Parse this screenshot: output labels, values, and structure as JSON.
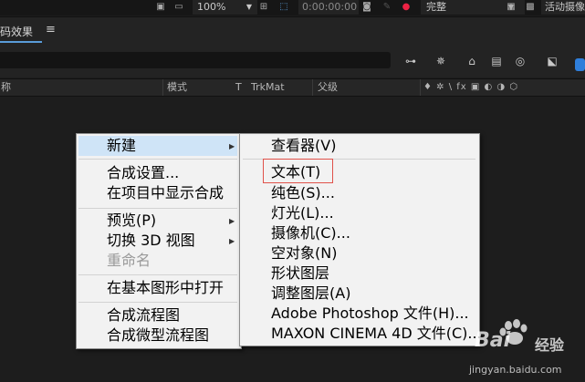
{
  "toolbar": {
    "zoom": "100%",
    "timecode": "0:00:00:00",
    "quality": "完整",
    "active_camera": "活动摄像"
  },
  "panel": {
    "title": "编码效果",
    "menu_glyph": "≡"
  },
  "columns": {
    "name": "名称",
    "mode": "模式",
    "t": "T",
    "trkmat": "TrkMat",
    "parent": "父级",
    "switches": "♦ ✲ \\ fx ▣ ◐ ◑ ⬡"
  },
  "main_menu": {
    "items": [
      {
        "label": "新建",
        "has_submenu": true,
        "highlighted": true
      },
      {
        "label": "合成设置..."
      },
      {
        "label": "在项目中显示合成"
      },
      {
        "label": "预览(P)",
        "has_submenu": true
      },
      {
        "label": "切换 3D 视图",
        "has_submenu": true
      },
      {
        "label": "重命名",
        "disabled": true
      },
      {
        "label": "在基本图形中打开"
      },
      {
        "label": "合成流程图"
      },
      {
        "label": "合成微型流程图"
      }
    ]
  },
  "sub_menu": {
    "items": [
      {
        "label": "查看器(V)"
      },
      {
        "label": "文本(T)",
        "annotated": true
      },
      {
        "label": "纯色(S)..."
      },
      {
        "label": "灯光(L)..."
      },
      {
        "label": "摄像机(C)..."
      },
      {
        "label": "空对象(N)"
      },
      {
        "label": "形状图层"
      },
      {
        "label": "调整图层(A)"
      },
      {
        "label": "Adobe Photoshop 文件(H)..."
      },
      {
        "label": "MAXON CINEMA 4D 文件(C)..."
      }
    ]
  },
  "watermark": {
    "brand": "Bai",
    "brand_cn": "经验",
    "url": "jingyan.baidu.com"
  },
  "colors": {
    "accent": "#2f7fdb",
    "annotation": "#e0514a",
    "menu_highlight": "#cfe4f7"
  }
}
